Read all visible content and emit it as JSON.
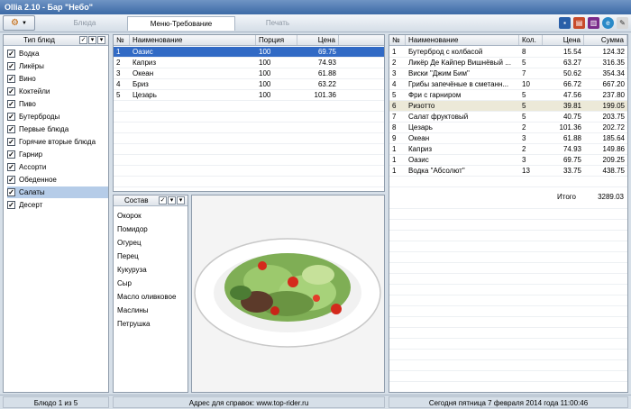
{
  "window": {
    "title": "Ollia 2.10 - Бар \"Небо\""
  },
  "toolbar": {
    "tabs": [
      {
        "label": "Блюда"
      },
      {
        "label": "Меню-Требование"
      },
      {
        "label": "Печать"
      }
    ]
  },
  "categories": {
    "header": "Тип блюд",
    "items": [
      {
        "label": "Водка"
      },
      {
        "label": "Ликёры"
      },
      {
        "label": "Вино"
      },
      {
        "label": "Коктейли"
      },
      {
        "label": "Пиво"
      },
      {
        "label": "Бутерброды"
      },
      {
        "label": "Первые блюда"
      },
      {
        "label": "Горячие вторые блюда"
      },
      {
        "label": "Гарнир"
      },
      {
        "label": "Ассорти"
      },
      {
        "label": "Обеденное"
      },
      {
        "label": "Салаты"
      },
      {
        "label": "Десерт"
      }
    ]
  },
  "dishes": {
    "columns": {
      "num": "№",
      "name": "Наименование",
      "portion": "Порция",
      "price": "Цена"
    },
    "rows": [
      {
        "num": "1",
        "name": "Оазис",
        "portion": "100",
        "price": "69.75"
      },
      {
        "num": "2",
        "name": "Каприз",
        "portion": "100",
        "price": "74.93"
      },
      {
        "num": "3",
        "name": "Океан",
        "portion": "100",
        "price": "61.88"
      },
      {
        "num": "4",
        "name": "Бриз",
        "portion": "100",
        "price": "63.22"
      },
      {
        "num": "5",
        "name": "Цезарь",
        "portion": "100",
        "price": "101.36"
      }
    ]
  },
  "composition": {
    "header": "Состав",
    "items": [
      "Окорок",
      "Помидор",
      "Огурец",
      "Перец",
      "Кукуруза",
      "Сыр",
      "Масло оливковое",
      "Маслины",
      "Петрушка"
    ]
  },
  "order": {
    "columns": {
      "num": "№",
      "name": "Наименование",
      "qty": "Кол.",
      "price": "Цена",
      "sum": "Сумма"
    },
    "rows": [
      {
        "num": "1",
        "name": "Бутерброд с колбасой",
        "qty": "8",
        "price": "15.54",
        "sum": "124.32"
      },
      {
        "num": "2",
        "name": "Ликёр Де Кайпер Вишнёвый ...",
        "qty": "5",
        "price": "63.27",
        "sum": "316.35"
      },
      {
        "num": "3",
        "name": "Виски \"Джим Бим\"",
        "qty": "7",
        "price": "50.62",
        "sum": "354.34"
      },
      {
        "num": "4",
        "name": "Грибы запечёные в сметанн...",
        "qty": "10",
        "price": "66.72",
        "sum": "667.20"
      },
      {
        "num": "5",
        "name": "Фри с гарниром",
        "qty": "5",
        "price": "47.56",
        "sum": "237.80"
      },
      {
        "num": "6",
        "name": "Ризотто",
        "qty": "5",
        "price": "39.81",
        "sum": "199.05"
      },
      {
        "num": "7",
        "name": "Салат фруктовый",
        "qty": "5",
        "price": "40.75",
        "sum": "203.75"
      },
      {
        "num": "8",
        "name": "Цезарь",
        "qty": "2",
        "price": "101.36",
        "sum": "202.72"
      },
      {
        "num": "9",
        "name": "Океан",
        "qty": "3",
        "price": "61.88",
        "sum": "185.64"
      },
      {
        "num": "1",
        "name": "Каприз",
        "qty": "2",
        "price": "74.93",
        "sum": "149.86"
      },
      {
        "num": "1",
        "name": "Оазис",
        "qty": "3",
        "price": "69.75",
        "sum": "209.25"
      },
      {
        "num": "1",
        "name": "Водка \"Абсолют\"",
        "qty": "13",
        "price": "33.75",
        "sum": "438.75"
      }
    ],
    "total_label": "Итого",
    "total_value": "3289.03"
  },
  "status": {
    "counter": "Блюдо 1 из 5",
    "help": "Адрес для справок: www.top-rider.ru",
    "datetime": "Сегодня  пятница  7 февраля 2014 года  11:00:46"
  }
}
